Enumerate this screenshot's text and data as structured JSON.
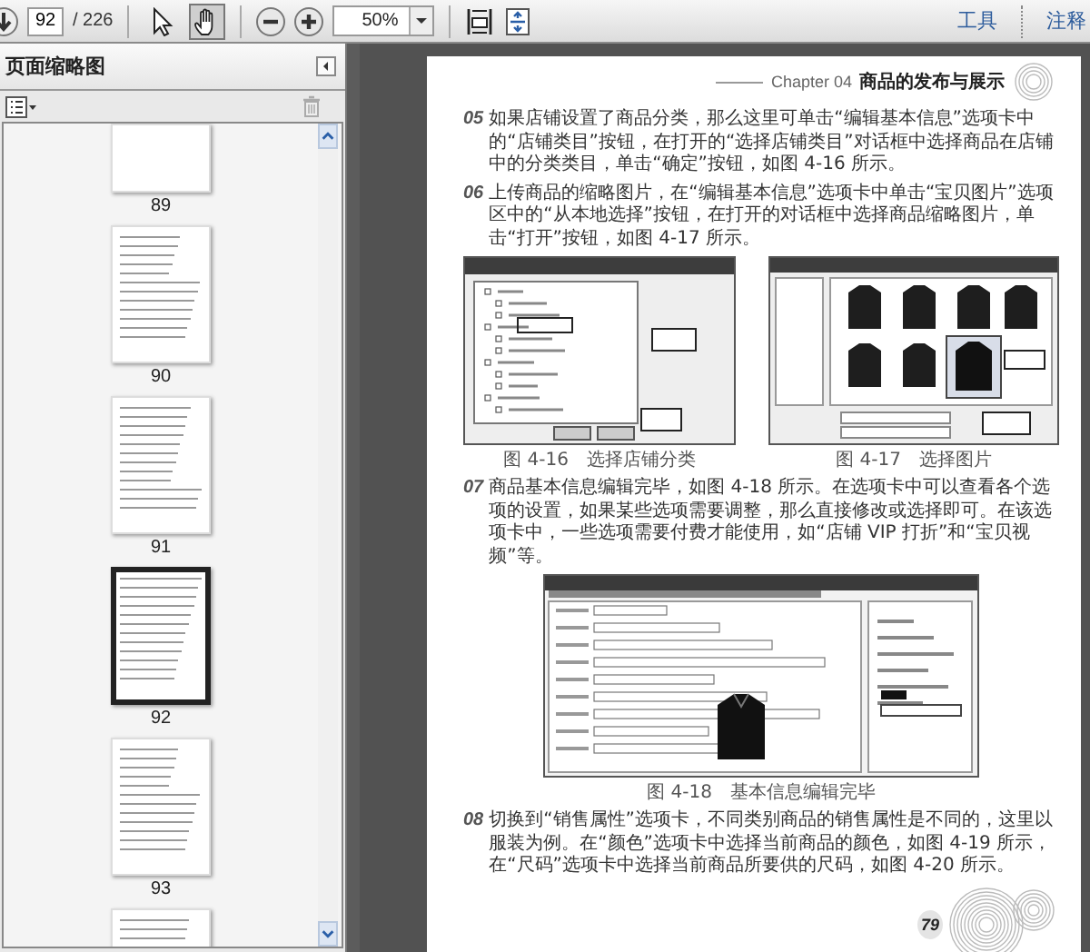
{
  "toolbar": {
    "page_field": {
      "value": "92"
    },
    "page_count": "/ 226",
    "tools": [
      {
        "kind": "select",
        "selected": false
      },
      {
        "kind": "hand",
        "selected": true
      }
    ],
    "zoom_field": {
      "value": "50%"
    },
    "panel_buttons": [
      "工具",
      "注释"
    ]
  },
  "sidebar": {
    "title": "页面缩略图",
    "thumbnails": [
      {
        "label": "89",
        "selected": false
      },
      {
        "label": "90",
        "selected": false
      },
      {
        "label": "91",
        "selected": false
      },
      {
        "label": "92",
        "selected": true
      },
      {
        "label": "93",
        "selected": false
      },
      {
        "selected": false
      }
    ]
  },
  "document": {
    "header": {
      "chapter": "Chapter 04",
      "title": "商品的发布与展示"
    },
    "blocks": [
      {
        "kind": "step",
        "number": "05",
        "text": "如果店铺设置了商品分类，那么这里可单击“编辑基本信息”选项卡中的“店铺类目”按钮，在打开的“选择店铺类目”对话框中选择商品在店铺中的分类类目，单击“确定”按钮，如图 4-16 所示。"
      },
      {
        "kind": "step",
        "number": "06",
        "text": "上传商品的缩略图片，在“编辑基本信息”选项卡中单击“宝贝图片”选项区中的“从本地选择”按钮，在打开的对话框中选择商品缩略图片，单击“打开”按钮，如图 4-17 所示。"
      },
      {
        "kind": "figures",
        "figures": [
          {
            "kind": "category_dialog",
            "caption": "图 4-16　选择店铺分类"
          },
          {
            "kind": "image_dialog",
            "caption": "图 4-17　选择图片"
          }
        ]
      },
      {
        "kind": "step",
        "number": "07",
        "text": "商品基本信息编辑完毕，如图 4-18 所示。在选项卡中可以查看各个选项的设置，如果某些选项需要调整，那么直接修改或选择即可。在该选项卡中，一些选项需要付费才能使用，如“店铺 VIP 打折”和“宝贝视频”等。"
      },
      {
        "kind": "figures",
        "figures": [
          {
            "kind": "info_form",
            "caption": "图 4-18　基本信息编辑完毕"
          }
        ]
      },
      {
        "kind": "step",
        "number": "08",
        "text": "切换到“销售属性”选项卡，不同类别商品的销售属性是不同的，这里以服装为例。在“颜色”选项卡中选择当前商品的颜色，如图 4-19 所示，在“尺码”选项卡中选择当前商品所要供的尺码，如图 4-20 所示。"
      }
    ],
    "page_number": "79"
  }
}
